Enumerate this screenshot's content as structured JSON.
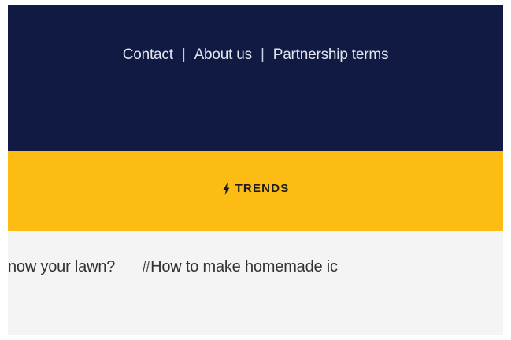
{
  "footer": {
    "links": [
      {
        "label": "Contact"
      },
      {
        "label": "About us"
      },
      {
        "label": "Partnership terms"
      }
    ],
    "separator": "|",
    "colors": {
      "background": "#111a43",
      "text": "#e2e5ee"
    }
  },
  "trends": {
    "icon": "lightning-bolt-icon",
    "label": "TRENDS",
    "colors": {
      "background": "#fdbc14",
      "text": "#1c1c1c"
    },
    "items": [
      {
        "label": "now your lawn?"
      },
      {
        "label": "#How to make homemade ic"
      }
    ],
    "strip_background": "#f4f4f4"
  }
}
